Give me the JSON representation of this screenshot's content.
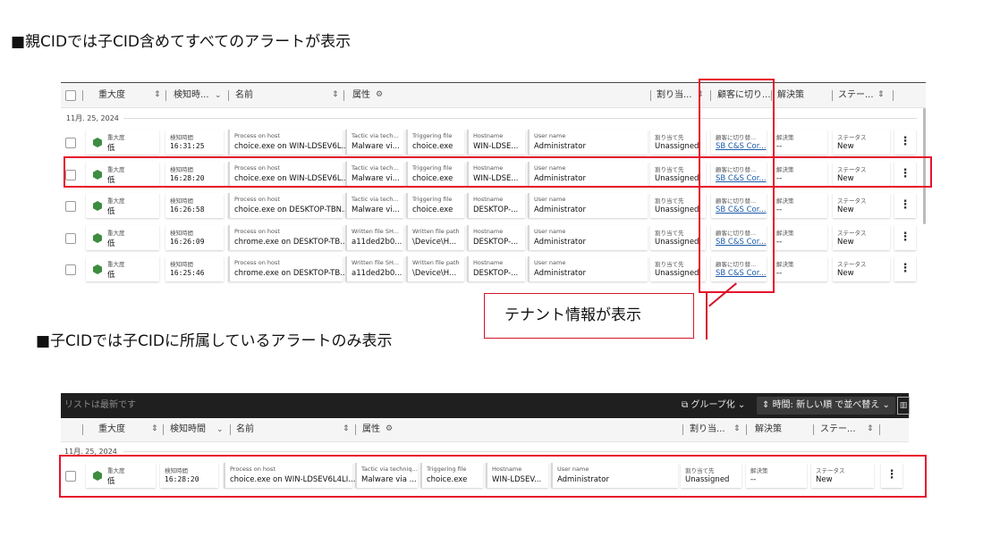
{
  "headings": {
    "parent": "■親CIDでは子CID含めてすべてのアラートが表示",
    "child": "■子CIDでは子CIDに所属しているアラートのみ表示"
  },
  "callout": "テナント情報が表示",
  "top": {
    "columns": {
      "severity": "重大度",
      "detect_time": "検知時...",
      "name": "名前",
      "attributes": "属性",
      "assign": "割り当...",
      "customer": "顧客に切り...",
      "resolution": "解決策",
      "status": "ステー..."
    },
    "date_group": "11月. 25, 2024",
    "labels": {
      "severity": "重大度",
      "time": "検知時間",
      "name": "Process on host",
      "hostname": "Hostname",
      "user": "User name",
      "assign": "割り当て先",
      "customer": "顧客に切り替...",
      "resolution": "解決策",
      "status": "ステータス"
    },
    "rows": [
      {
        "sev": "低",
        "time": "16:31:25",
        "name": "choice.exe on WIN-LDSEV6L...",
        "a1l": "Tactic via tech...",
        "a1v": "Malware vi...",
        "a2l": "Triggering file",
        "a2v": "choice.exe",
        "host": "WIN-LDSE...",
        "user": "Administrator",
        "assign": "Unassigned",
        "customer": "SB C&S Cor...",
        "res": "--",
        "status": "New"
      },
      {
        "sev": "低",
        "time": "16:28:20",
        "name": "choice.exe on WIN-LDSEV6L...",
        "a1l": "Tactic via tech...",
        "a1v": "Malware vi...",
        "a2l": "Triggering file",
        "a2v": "choice.exe",
        "host": "WIN-LDSE...",
        "user": "Administrator",
        "assign": "Unassigned",
        "customer": "SB C&S Cor...",
        "res": "--",
        "status": "New"
      },
      {
        "sev": "低",
        "time": "16:26:58",
        "name": "choice.exe on DESKTOP-TBN...",
        "a1l": "Tactic via tech...",
        "a1v": "Malware vi...",
        "a2l": "Triggering file",
        "a2v": "choice.exe",
        "host": "DESKTOP-...",
        "user": "Administrator",
        "assign": "Unassigned",
        "customer": "SB C&S Cor...",
        "res": "--",
        "status": "New"
      },
      {
        "sev": "低",
        "time": "16:26:09",
        "name": "chrome.exe on DESKTOP-TB...",
        "a1l": "Written file SH...",
        "a1v": "a11ded2b0...",
        "a2l": "Written file path",
        "a2v": "\\Device\\H...",
        "host": "DESKTOP-...",
        "user": "Administrator",
        "assign": "Unassigned",
        "customer": "SB C&S Cor...",
        "res": "--",
        "status": "New"
      },
      {
        "sev": "低",
        "time": "16:25:46",
        "name": "chrome.exe on DESKTOP-TB...",
        "a1l": "Written file SH...",
        "a1v": "a11ded2b0...",
        "a2l": "Written file path",
        "a2v": "\\Device\\H...",
        "host": "DESKTOP-...",
        "user": "Administrator",
        "assign": "Unassigned",
        "customer": "SB C&S Cor...",
        "res": "--",
        "status": "New"
      }
    ]
  },
  "bottom": {
    "bar_message": "リストは最新です",
    "group_label": "グループ化",
    "sort_label": "時間: 新しい順 で並べ替え",
    "columns": {
      "severity": "重大度",
      "detect_time": "検知時間",
      "name": "名前",
      "attributes": "属性",
      "assign": "割り当...",
      "resolution": "解決策",
      "status": "ステー..."
    },
    "date_group": "11月. 25, 2024",
    "row": {
      "sev_label": "重大度",
      "sev": "低",
      "time_label": "検知時間",
      "time": "16:28:20",
      "name_label": "Process on host",
      "name": "choice.exe on WIN-LDSEV6L4LI...",
      "a1l": "Tactic via techniq...",
      "a1v": "Malware via ...",
      "a2l": "Triggering file",
      "a2v": "choice.exe",
      "host_label": "Hostname",
      "host": "WIN-LDSEV...",
      "user_label": "User name",
      "user": "Administrator",
      "assign_label": "割り当て先",
      "assign": "Unassigned",
      "res_label": "解決策",
      "res": "--",
      "status_label": "ステータス",
      "status": "New"
    }
  }
}
